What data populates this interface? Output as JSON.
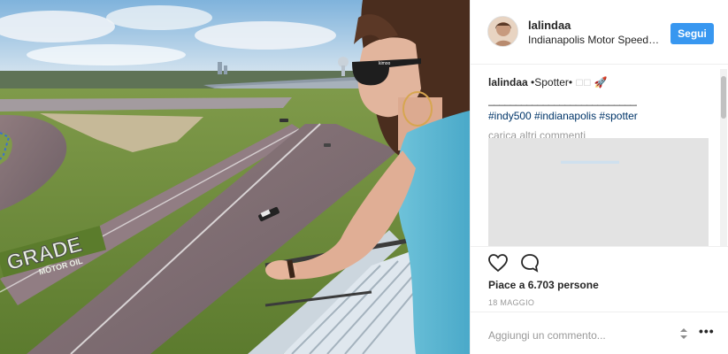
{
  "post": {
    "username": "lalindaa",
    "location": "Indianapolis Motor Speedway",
    "follow_label": "Segui",
    "caption_text": "•Spotter•",
    "caption_emoji": "🚀",
    "caption_divider": "_________________________________",
    "hashtags": "#indy500 #indianapolis #spotter",
    "load_more": "carica altri commenti",
    "likes": "Piace a 6.703 persone",
    "date": "18 MAGGIO",
    "comment_placeholder": "Aggiungi un commento...",
    "more_glyph": "•••"
  },
  "photo": {
    "sign_text": "GRADE",
    "sign_subtext": "MOTOR OIL",
    "sunglasses_brand": "kimoo"
  },
  "icons": {
    "like": "heart-icon",
    "comment": "comment-bubble-icon",
    "more": "more-options-icon",
    "resize": "resize-icon"
  },
  "colors": {
    "accent": "#3897f0",
    "hashtag": "#003569",
    "muted": "#999999",
    "text": "#262626"
  }
}
